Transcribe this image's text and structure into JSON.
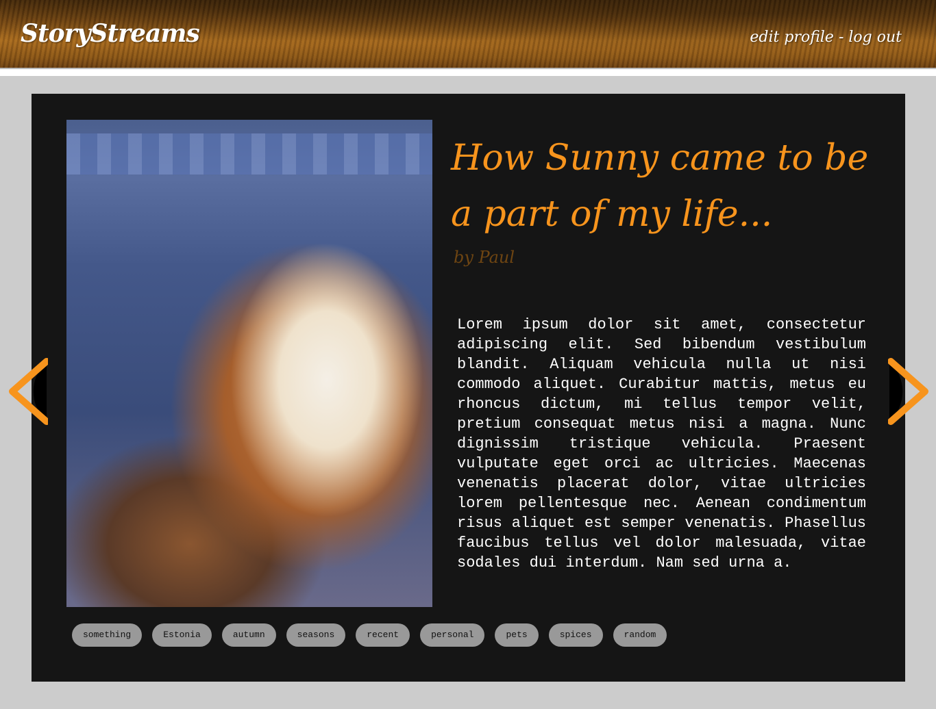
{
  "header": {
    "logo": "StoryStreams",
    "nav": {
      "edit_profile": "edit profile",
      "separator": " - ",
      "log_out": "log out"
    }
  },
  "story": {
    "title": "How Sunny came to be a part of my life...",
    "byline": "by Paul",
    "body": "Lorem ipsum dolor sit amet, consectetur adipiscing elit. Sed bibendum vestibulum blandit. Aliquam vehicula nulla ut nisi commodo aliquet. Curabitur mattis, metus eu rhoncus dictum, mi tellus tempor velit, pretium consequat metus nisi a magna. Nunc dignissim tristique vehicula. Praesent vulputate eget orci ac ultricies. Maecenas venenatis placerat dolor, vitae ultricies lorem pellentesque nec. Aenean condimentum risus aliquet est semper venenatis. Phasellus faucibus tellus vel dolor malesuada, vitae sodales dui interdum. Nam sed urna a.",
    "image": "cat-photo"
  },
  "tags": [
    "something",
    "Estonia",
    "autumn",
    "seasons",
    "recent",
    "personal",
    "pets",
    "spices",
    "random"
  ],
  "navigation": {
    "prev_icon": "chevron-left-icon",
    "next_icon": "chevron-right-icon"
  },
  "colors": {
    "accent": "#f7941d",
    "panel": "#151515",
    "background": "#cccccc",
    "tag": "#999999"
  }
}
